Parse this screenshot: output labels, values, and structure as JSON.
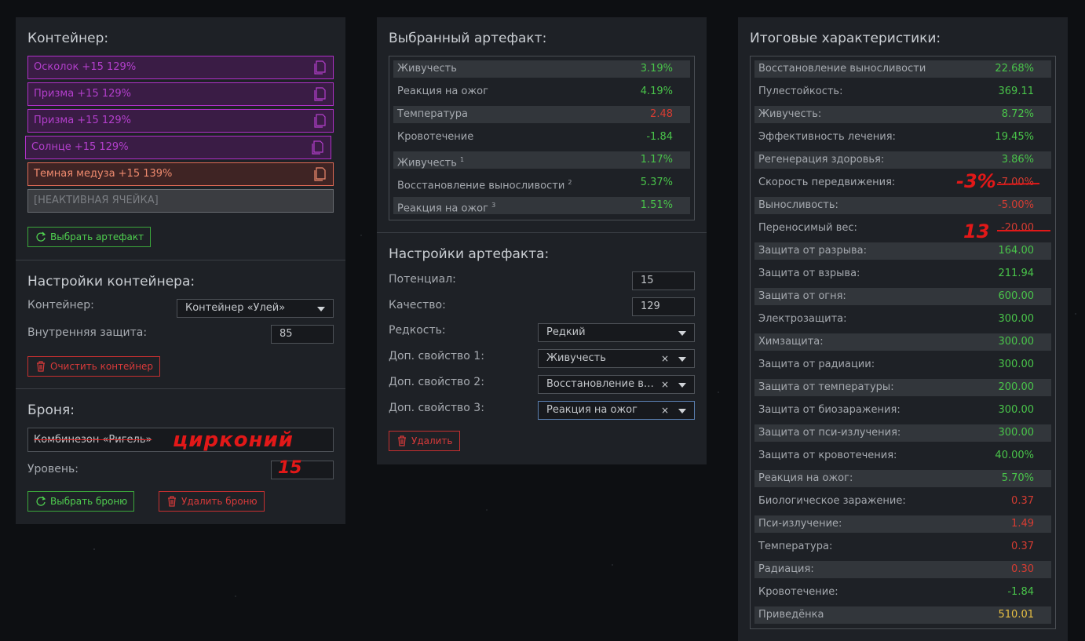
{
  "container_panel": {
    "title": "Контейнер:",
    "slots": [
      {
        "label": "Осколок +15 129%",
        "style": "purple"
      },
      {
        "label": "Призма +15 129%",
        "style": "purple"
      },
      {
        "label": "Призма +15 129%",
        "style": "purple"
      },
      {
        "label": "Солнце +15 129%",
        "style": "purple"
      },
      {
        "label": "Темная медуза +15 139%",
        "style": "orange"
      },
      {
        "label": "[НЕАКТИВНАЯ ЯЧЕЙКА]",
        "style": "inactive"
      }
    ],
    "select_artifact_button": "Выбрать артефакт",
    "settings_title": "Настройки контейнера:",
    "container_label": "Контейнер:",
    "container_value": "Контейнер «Улей»",
    "inner_protection_label": "Внутренняя защита:",
    "inner_protection_value": "85",
    "clear_button": "Очистить контейнер",
    "armor_title": "Броня:",
    "armor_value": "Комбинезон «Ригель»",
    "armor_handwritten": "цирконий",
    "level_label": "Уровень:",
    "level_handwritten": "15",
    "select_armor_button": "Выбрать броню",
    "delete_armor_button": "Удалить броню"
  },
  "artifact_panel": {
    "title": "Выбранный артефакт:",
    "stats": [
      {
        "name": "Живучесть",
        "sup": "",
        "value": "3.19%",
        "color": "g"
      },
      {
        "name": "Реакция на ожог",
        "sup": "",
        "value": "4.19%",
        "color": "g"
      },
      {
        "name": "Температура",
        "sup": "",
        "value": "2.48",
        "color": "r"
      },
      {
        "name": "Кровотечение",
        "sup": "",
        "value": "-1.84",
        "color": "g"
      },
      {
        "name": "Живучесть",
        "sup": "1",
        "value": "1.17%",
        "color": "g"
      },
      {
        "name": "Восстановление выносливости",
        "sup": "2",
        "value": "5.37%",
        "color": "g"
      },
      {
        "name": "Реакция на ожог",
        "sup": "3",
        "value": "1.51%",
        "color": "g"
      }
    ],
    "settings_title": "Настройки артефакта:",
    "potential_label": "Потенциал:",
    "potential_value": "15",
    "quality_label": "Качество:",
    "quality_value": "129",
    "rarity_label": "Редкость:",
    "rarity_value": "Редкий",
    "extra1_label": "Доп. свойство 1:",
    "extra1_value": "Живучесть",
    "extra2_label": "Доп. свойство 2:",
    "extra2_value": "Восстановление выносливости",
    "extra3_label": "Доп. свойство 3:",
    "extra3_value": "Реакция на ожог",
    "clear_symbol": "×",
    "delete_button": "Удалить"
  },
  "totals_panel": {
    "title": "Итоговые характеристики:",
    "stats": [
      {
        "name": "Восстановление выносливости",
        "value": "22.68%",
        "color": "g"
      },
      {
        "name": "Пулестойкость:",
        "value": "369.11",
        "color": "g"
      },
      {
        "name": "Живучесть:",
        "value": "8.72%",
        "color": "g"
      },
      {
        "name": "Эффективность лечения:",
        "value": "19.45%",
        "color": "g"
      },
      {
        "name": "Регенерация здоровья:",
        "value": "3.86%",
        "color": "g"
      },
      {
        "name": "Скорость передвижения:",
        "value": "-7.00%",
        "color": "r"
      },
      {
        "name": "Выносливость:",
        "value": "-5.00%",
        "color": "r"
      },
      {
        "name": "Переносимый вес:",
        "value": "-20.00",
        "color": "r"
      },
      {
        "name": "Защита от разрыва:",
        "value": "164.00",
        "color": "g"
      },
      {
        "name": "Защита от взрыва:",
        "value": "211.94",
        "color": "g"
      },
      {
        "name": "Защита от огня:",
        "value": "600.00",
        "color": "g"
      },
      {
        "name": "Электрозащита:",
        "value": "300.00",
        "color": "g"
      },
      {
        "name": "Химзащита:",
        "value": "300.00",
        "color": "g"
      },
      {
        "name": "Защита от радиации:",
        "value": "300.00",
        "color": "g"
      },
      {
        "name": "Защита от температуры:",
        "value": "200.00",
        "color": "g"
      },
      {
        "name": "Защита от биозаражения:",
        "value": "300.00",
        "color": "g"
      },
      {
        "name": "Защита от пси-излучения:",
        "value": "300.00",
        "color": "g"
      },
      {
        "name": "Защита от кровотечения:",
        "value": "40.00%",
        "color": "g"
      },
      {
        "name": "Реакция на ожог:",
        "value": "5.70%",
        "color": "g"
      },
      {
        "name": "Биологическое заражение:",
        "value": "0.37",
        "color": "r"
      },
      {
        "name": "Пси-излучение:",
        "value": "1.49",
        "color": "r"
      },
      {
        "name": "Температура:",
        "value": "0.37",
        "color": "r"
      },
      {
        "name": "Радиация:",
        "value": "0.30",
        "color": "r"
      },
      {
        "name": "Кровотечение:",
        "value": "-1.84",
        "color": "g"
      },
      {
        "name": "Приведёнка",
        "value": "510.01",
        "color": "y"
      }
    ],
    "handwritten_speed": "-3%",
    "handwritten_weight": "13"
  },
  "colors": {
    "panel_bg": "#1e2126",
    "green": "#49c44a",
    "red": "#d63c32",
    "purple": "#b33fcc",
    "gold": "#e8c043"
  }
}
